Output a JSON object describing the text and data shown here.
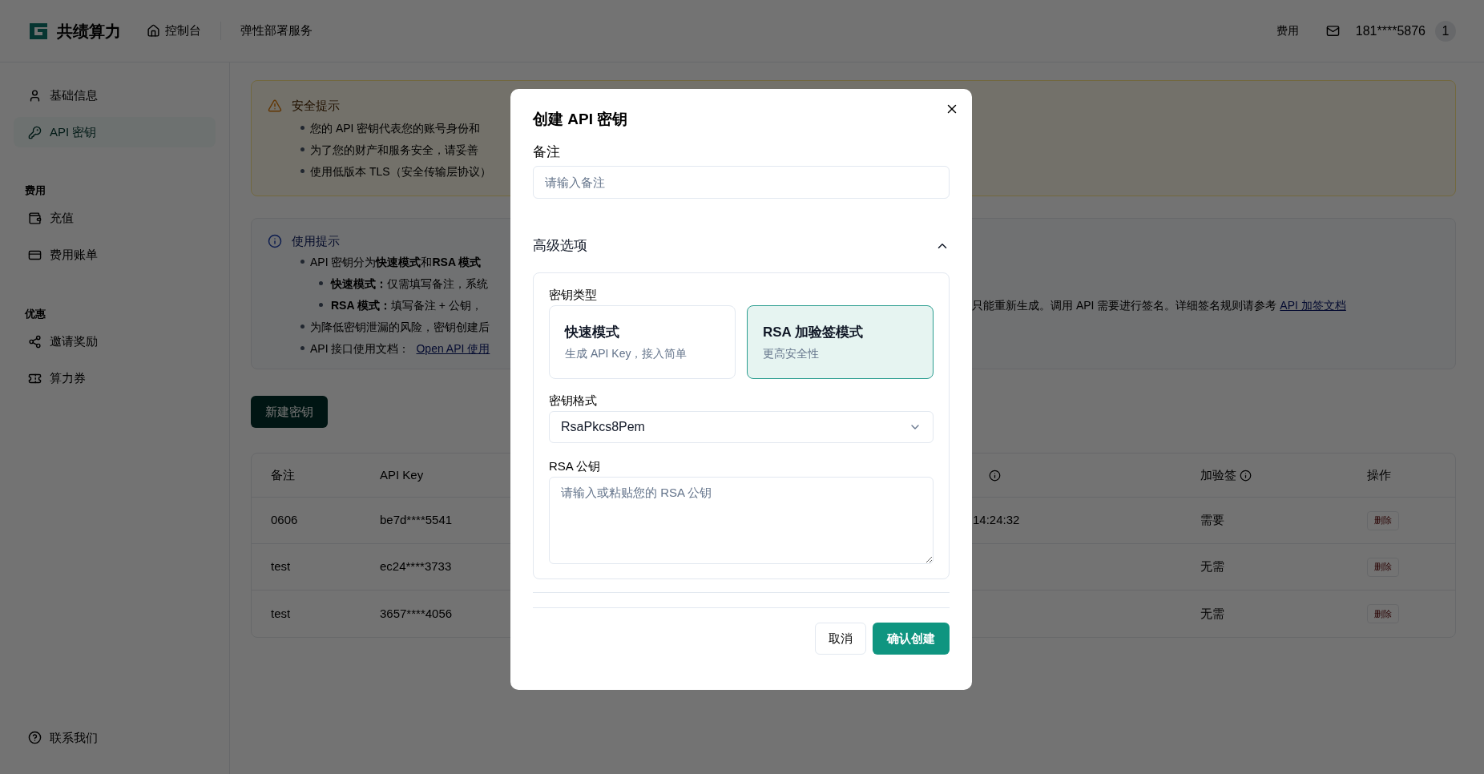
{
  "header": {
    "brand": "共绩算力",
    "nav": [
      {
        "label": "控制台",
        "kind": "home"
      },
      {
        "label": "弹性部署服务",
        "kind": "plain"
      }
    ],
    "fees": "费用",
    "user": "181****5876",
    "avatar": "1"
  },
  "sidebar": {
    "groups": [
      {
        "items": [
          {
            "label": "基础信息",
            "selected": false
          },
          {
            "label": "API 密钥",
            "selected": true
          }
        ]
      },
      {
        "title": "费用",
        "items": [
          {
            "label": "充值",
            "selected": false
          },
          {
            "label": "费用账单",
            "selected": false
          }
        ]
      },
      {
        "title": "优惠",
        "items": [
          {
            "label": "邀请奖励",
            "selected": false
          },
          {
            "label": "算力券",
            "selected": false
          }
        ]
      }
    ],
    "footer": "联系我们"
  },
  "security_notice": {
    "title": "安全提示",
    "items": [
      "您的 API 密钥代表您的账号身份和",
      "为了您的财产和服务安全，请妥善",
      "使用低版本 TLS（安全传输层协议）"
    ]
  },
  "usage_notice": {
    "title": "使用提示",
    "items": [
      {
        "text": "API 密钥分为**快速模式**和**RSA 模式**",
        "children": [
          {
            "text": "**快速模式：**仅需填写备注，系统"
          },
          {
            "text": "**RSA 模式：**填写备注 + 公钥，",
            "continuation": "只能重新生成。调用 API 需要进行签名。详细签名规则请参考",
            "link": "API 加签文档"
          }
        ]
      },
      {
        "text": "为降低密钥泄漏的风险，密钥创建后"
      },
      {
        "text": "API 接口使用文档：",
        "link": "Open API 使用"
      }
    ]
  },
  "new_key_button": "新建密钥",
  "table": {
    "columns": [
      {
        "label": "备注",
        "info": false
      },
      {
        "label": "API Key",
        "info": false
      },
      {
        "info": true
      },
      {
        "label": "加验签",
        "info": true
      },
      {
        "label": "操作",
        "info": false
      }
    ],
    "rows": [
      {
        "note": "0606",
        "key": "be7d****5541",
        "column_3": "14:24:32",
        "sign": "需要",
        "action": "删除"
      },
      {
        "note": "test",
        "key": "ec24****3733",
        "sign": "无需",
        "action": "删除"
      },
      {
        "note": "test",
        "key": "3657****4056",
        "sign": "无需",
        "action": "删除"
      }
    ]
  },
  "dialog": {
    "title": "创建 API 密钥",
    "note_label": "备注",
    "note_placeholder": "请输入备注",
    "advanced": {
      "label": "高级选项",
      "expanded": true,
      "key_type_label": "密钥类型",
      "options": [
        {
          "title": "快速模式",
          "desc": "生成 API Key，接入简单",
          "selected": false
        },
        {
          "title": "RSA 加验签模式",
          "desc": "更高安全性",
          "selected": true
        }
      ],
      "format_label": "密钥格式",
      "format_value": "RsaPkcs8Pem",
      "pubkey_label": "RSA 公钥",
      "pubkey_placeholder": "请输入或粘贴您的 RSA 公钥"
    },
    "cancel": "取消",
    "confirm": "确认创建"
  }
}
